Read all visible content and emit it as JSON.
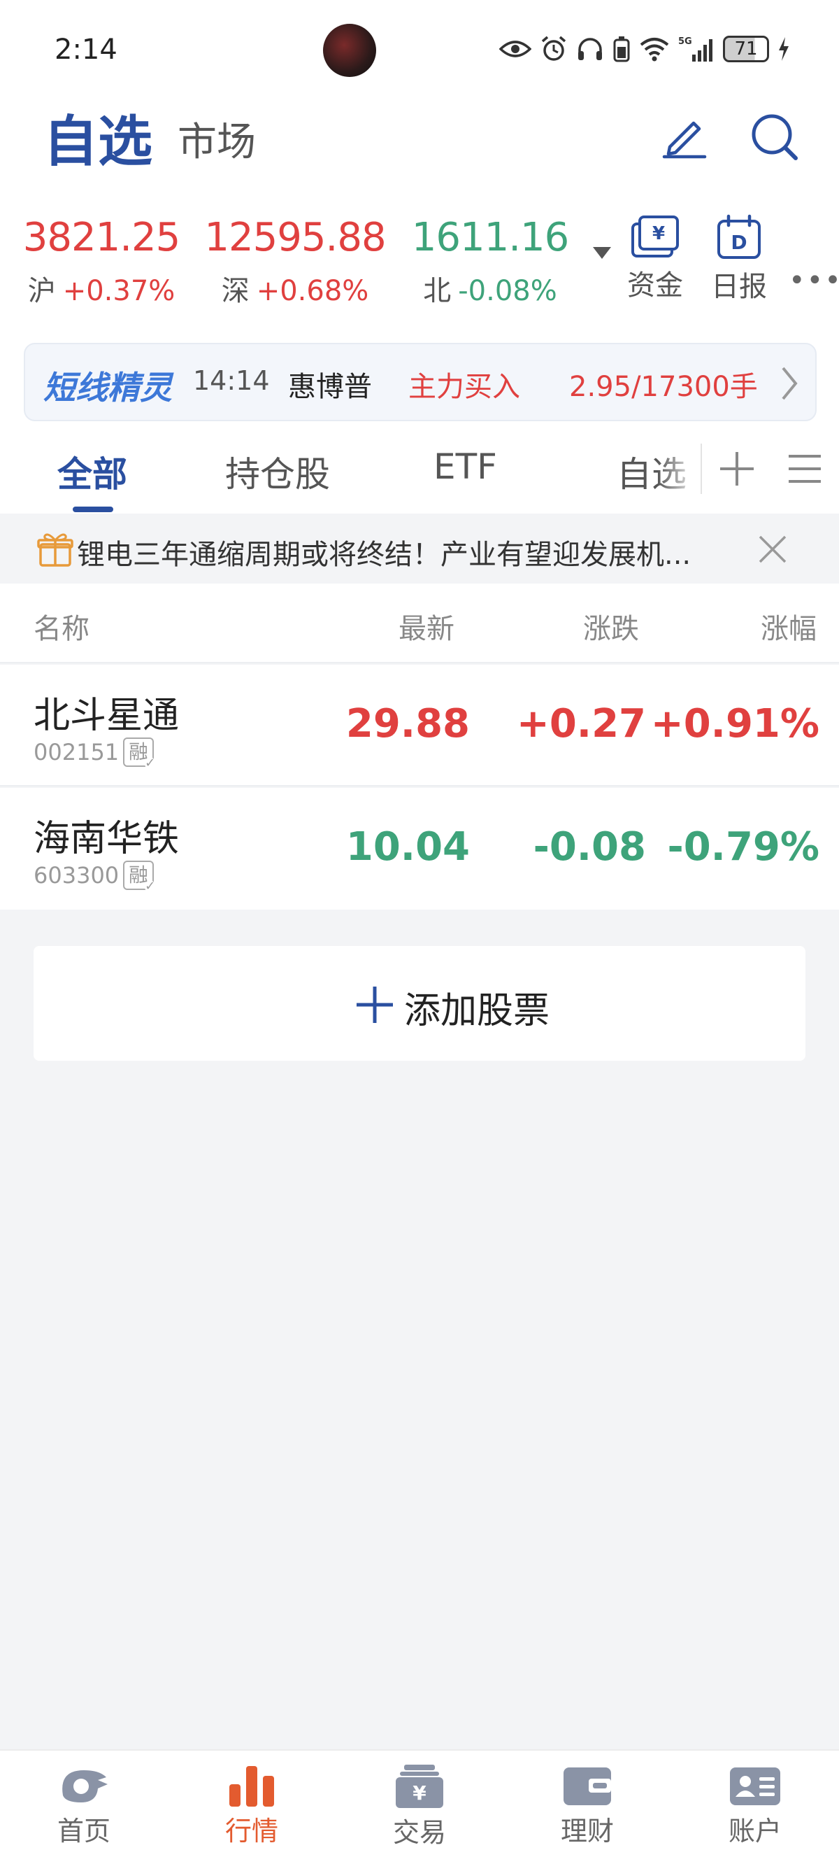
{
  "status_bar": {
    "time": "2:14",
    "battery": "71"
  },
  "header": {
    "title": "自选",
    "market": "市场"
  },
  "indices": [
    {
      "value": "3821.25",
      "name": "沪",
      "change": "+0.37%",
      "trend": "up"
    },
    {
      "value": "12595.88",
      "name": "深",
      "change": "+0.68%",
      "trend": "up"
    },
    {
      "value": "1611.16",
      "name": "北",
      "change": "-0.08%",
      "trend": "down"
    }
  ],
  "shortcuts": {
    "funds_label": "资金",
    "daily_label": "日报"
  },
  "wizard": {
    "brand": "短线精灵",
    "time": "14:14",
    "stock": "惠博普",
    "action": "主力买入",
    "detail": "2.95/17300手"
  },
  "tabs": [
    {
      "label": "全部",
      "active": true
    },
    {
      "label": "持仓股",
      "active": false
    },
    {
      "label": "ETF",
      "active": false
    },
    {
      "label": "自选",
      "active": false
    }
  ],
  "banner": {
    "text": "锂电三年通缩周期或将终结！产业有望迎发展机..."
  },
  "table": {
    "headers": {
      "name": "名称",
      "latest": "最新",
      "change": "涨跌",
      "pct": "涨幅"
    },
    "rows": [
      {
        "name": "北斗星通",
        "code": "002151",
        "badge": "融",
        "latest": "29.88",
        "change": "+0.27",
        "pct": "+0.91%",
        "trend": "up"
      },
      {
        "name": "海南华铁",
        "code": "603300",
        "badge": "融",
        "latest": "10.04",
        "change": "-0.08",
        "pct": "-0.79%",
        "trend": "down"
      }
    ]
  },
  "add_button": {
    "label": "添加股票"
  },
  "bottom_nav": [
    {
      "label": "首页",
      "icon": "home-icon",
      "active": false
    },
    {
      "label": "行情",
      "icon": "market-chart-icon",
      "active": true
    },
    {
      "label": "交易",
      "icon": "trade-yuan-icon",
      "active": false
    },
    {
      "label": "理财",
      "icon": "wallet-icon",
      "active": false
    },
    {
      "label": "账户",
      "icon": "account-card-icon",
      "active": false
    }
  ],
  "colors": {
    "brand_blue": "#2a4fa0",
    "up_red": "#e0403f",
    "down_green": "#3ea37a",
    "nav_active": "#e35b2f"
  }
}
